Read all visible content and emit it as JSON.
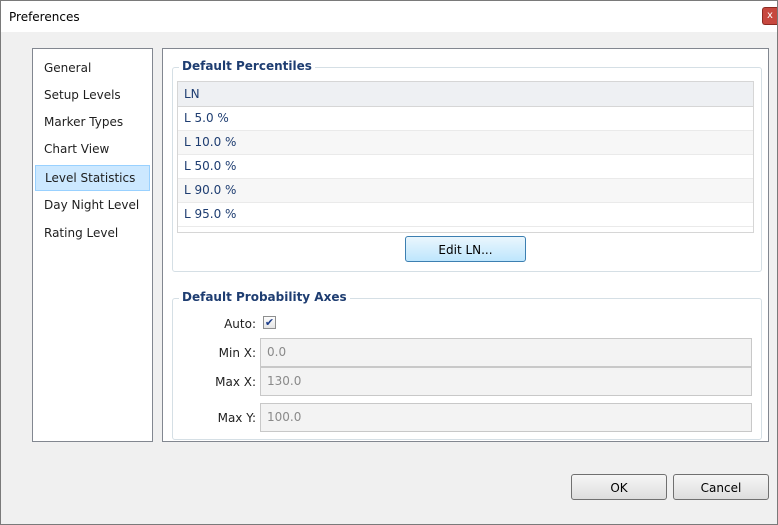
{
  "window": {
    "title": "Preferences",
    "close_glyph": "x"
  },
  "sidebar": {
    "items": [
      {
        "label": "General"
      },
      {
        "label": "Setup Levels"
      },
      {
        "label": "Marker Types"
      },
      {
        "label": "Chart View"
      },
      {
        "label": "Level Statistics",
        "selected": true
      },
      {
        "label": "Day Night Level"
      },
      {
        "label": "Rating Level"
      }
    ]
  },
  "percentiles": {
    "group_label": "Default Percentiles",
    "column_header": "LN",
    "rows": [
      "L 5.0 %",
      "L 10.0 %",
      "L 50.0 %",
      "L 90.0 %",
      "L 95.0 %"
    ],
    "edit_button": "Edit LN..."
  },
  "probability_axes": {
    "group_label": "Default Probability Axes",
    "auto_label": "Auto:",
    "auto_checked": true,
    "check_glyph": "✔",
    "min_x_label": "Min X:",
    "min_x_value": "0.0",
    "max_x_label": "Max X:",
    "max_x_value": "130.0",
    "max_y_label": "Max Y:",
    "max_y_value": "100.0"
  },
  "footer": {
    "ok_label": "OK",
    "cancel_label": "Cancel"
  },
  "colors": {
    "accent": "#1e3d71",
    "selection": "#cce8ff"
  }
}
